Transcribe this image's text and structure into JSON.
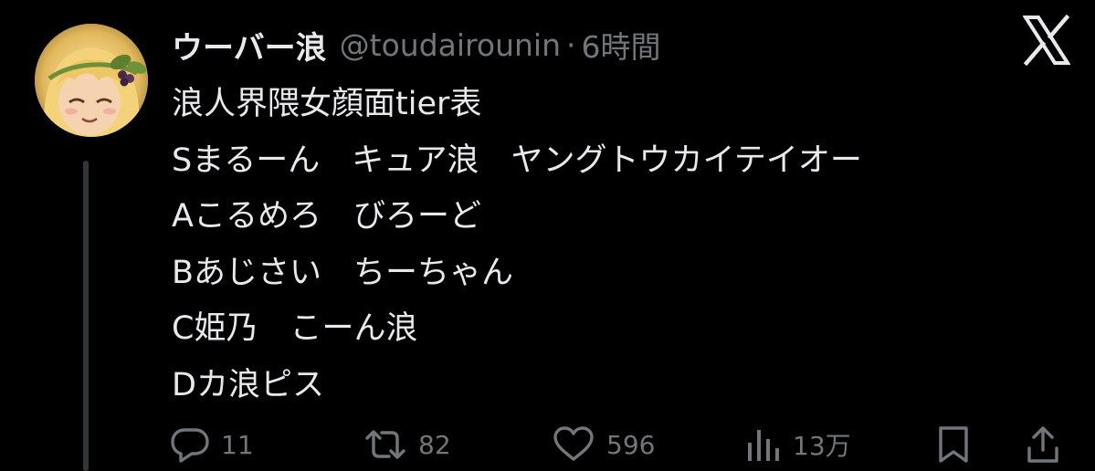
{
  "tweet": {
    "display_name": "ウーバー浪",
    "handle": "@toudairounin",
    "separator": "·",
    "time": "6時間",
    "lines": [
      "浪人界隈女顔面tier表",
      "Sまるーん　キュア浪　ヤングトウカイテイオー",
      "Aこるめろ　びろーど",
      "Bあじさい　ちーちゃん",
      "C姫乃　こーん浪",
      "Dカ浪ピス"
    ]
  },
  "actions": {
    "reply_count": "11",
    "repost_count": "82",
    "like_count": "596",
    "views_count": "13万"
  },
  "icons": {
    "avatar": "anime-character-avatar",
    "brand": "x-logo-icon",
    "reply": "reply-icon",
    "repost": "repost-icon",
    "like": "heart-icon",
    "views": "views-icon",
    "bookmark": "bookmark-icon",
    "share": "share-icon"
  },
  "colors": {
    "background": "#000000",
    "primary_text": "#e7e9ea",
    "secondary_text": "#71767b",
    "thread_line": "#333639"
  }
}
